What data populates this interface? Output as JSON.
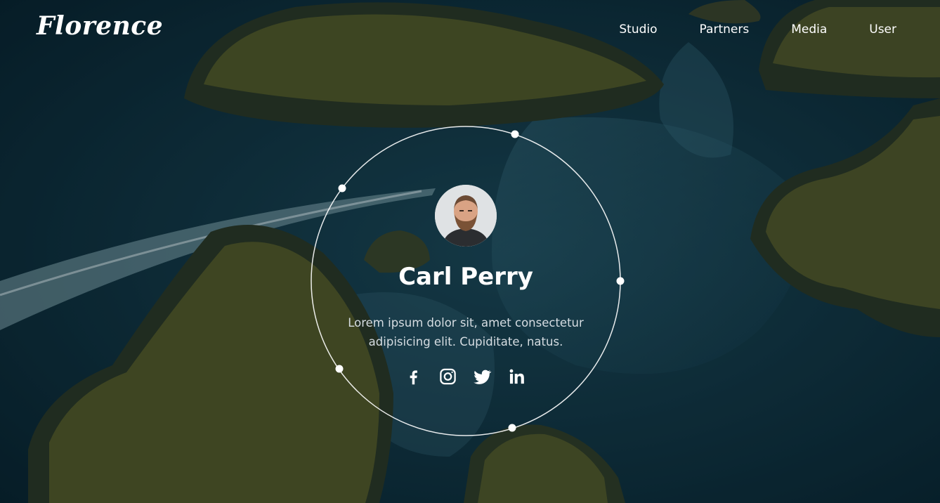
{
  "brand": {
    "logo": "Florence"
  },
  "nav": {
    "items": [
      {
        "label": "Studio"
      },
      {
        "label": "Partners"
      },
      {
        "label": "Media"
      },
      {
        "label": "User"
      }
    ]
  },
  "profile": {
    "name": "Carl Perry",
    "bio_line1": "Lorem ipsum dolor sit, amet consectetur",
    "bio_line2": "adipisicing elit. Cupiditate, natus."
  },
  "social": [
    {
      "icon": "facebook-icon"
    },
    {
      "icon": "instagram-icon"
    },
    {
      "icon": "twitter-icon"
    },
    {
      "icon": "linkedin-icon"
    }
  ],
  "colors": {
    "water_deep": "#0b2a38",
    "water_light": "#1c4a5a",
    "island": "#2f3a22",
    "foliage": "#6b6a28",
    "accent": "#ffffff"
  }
}
